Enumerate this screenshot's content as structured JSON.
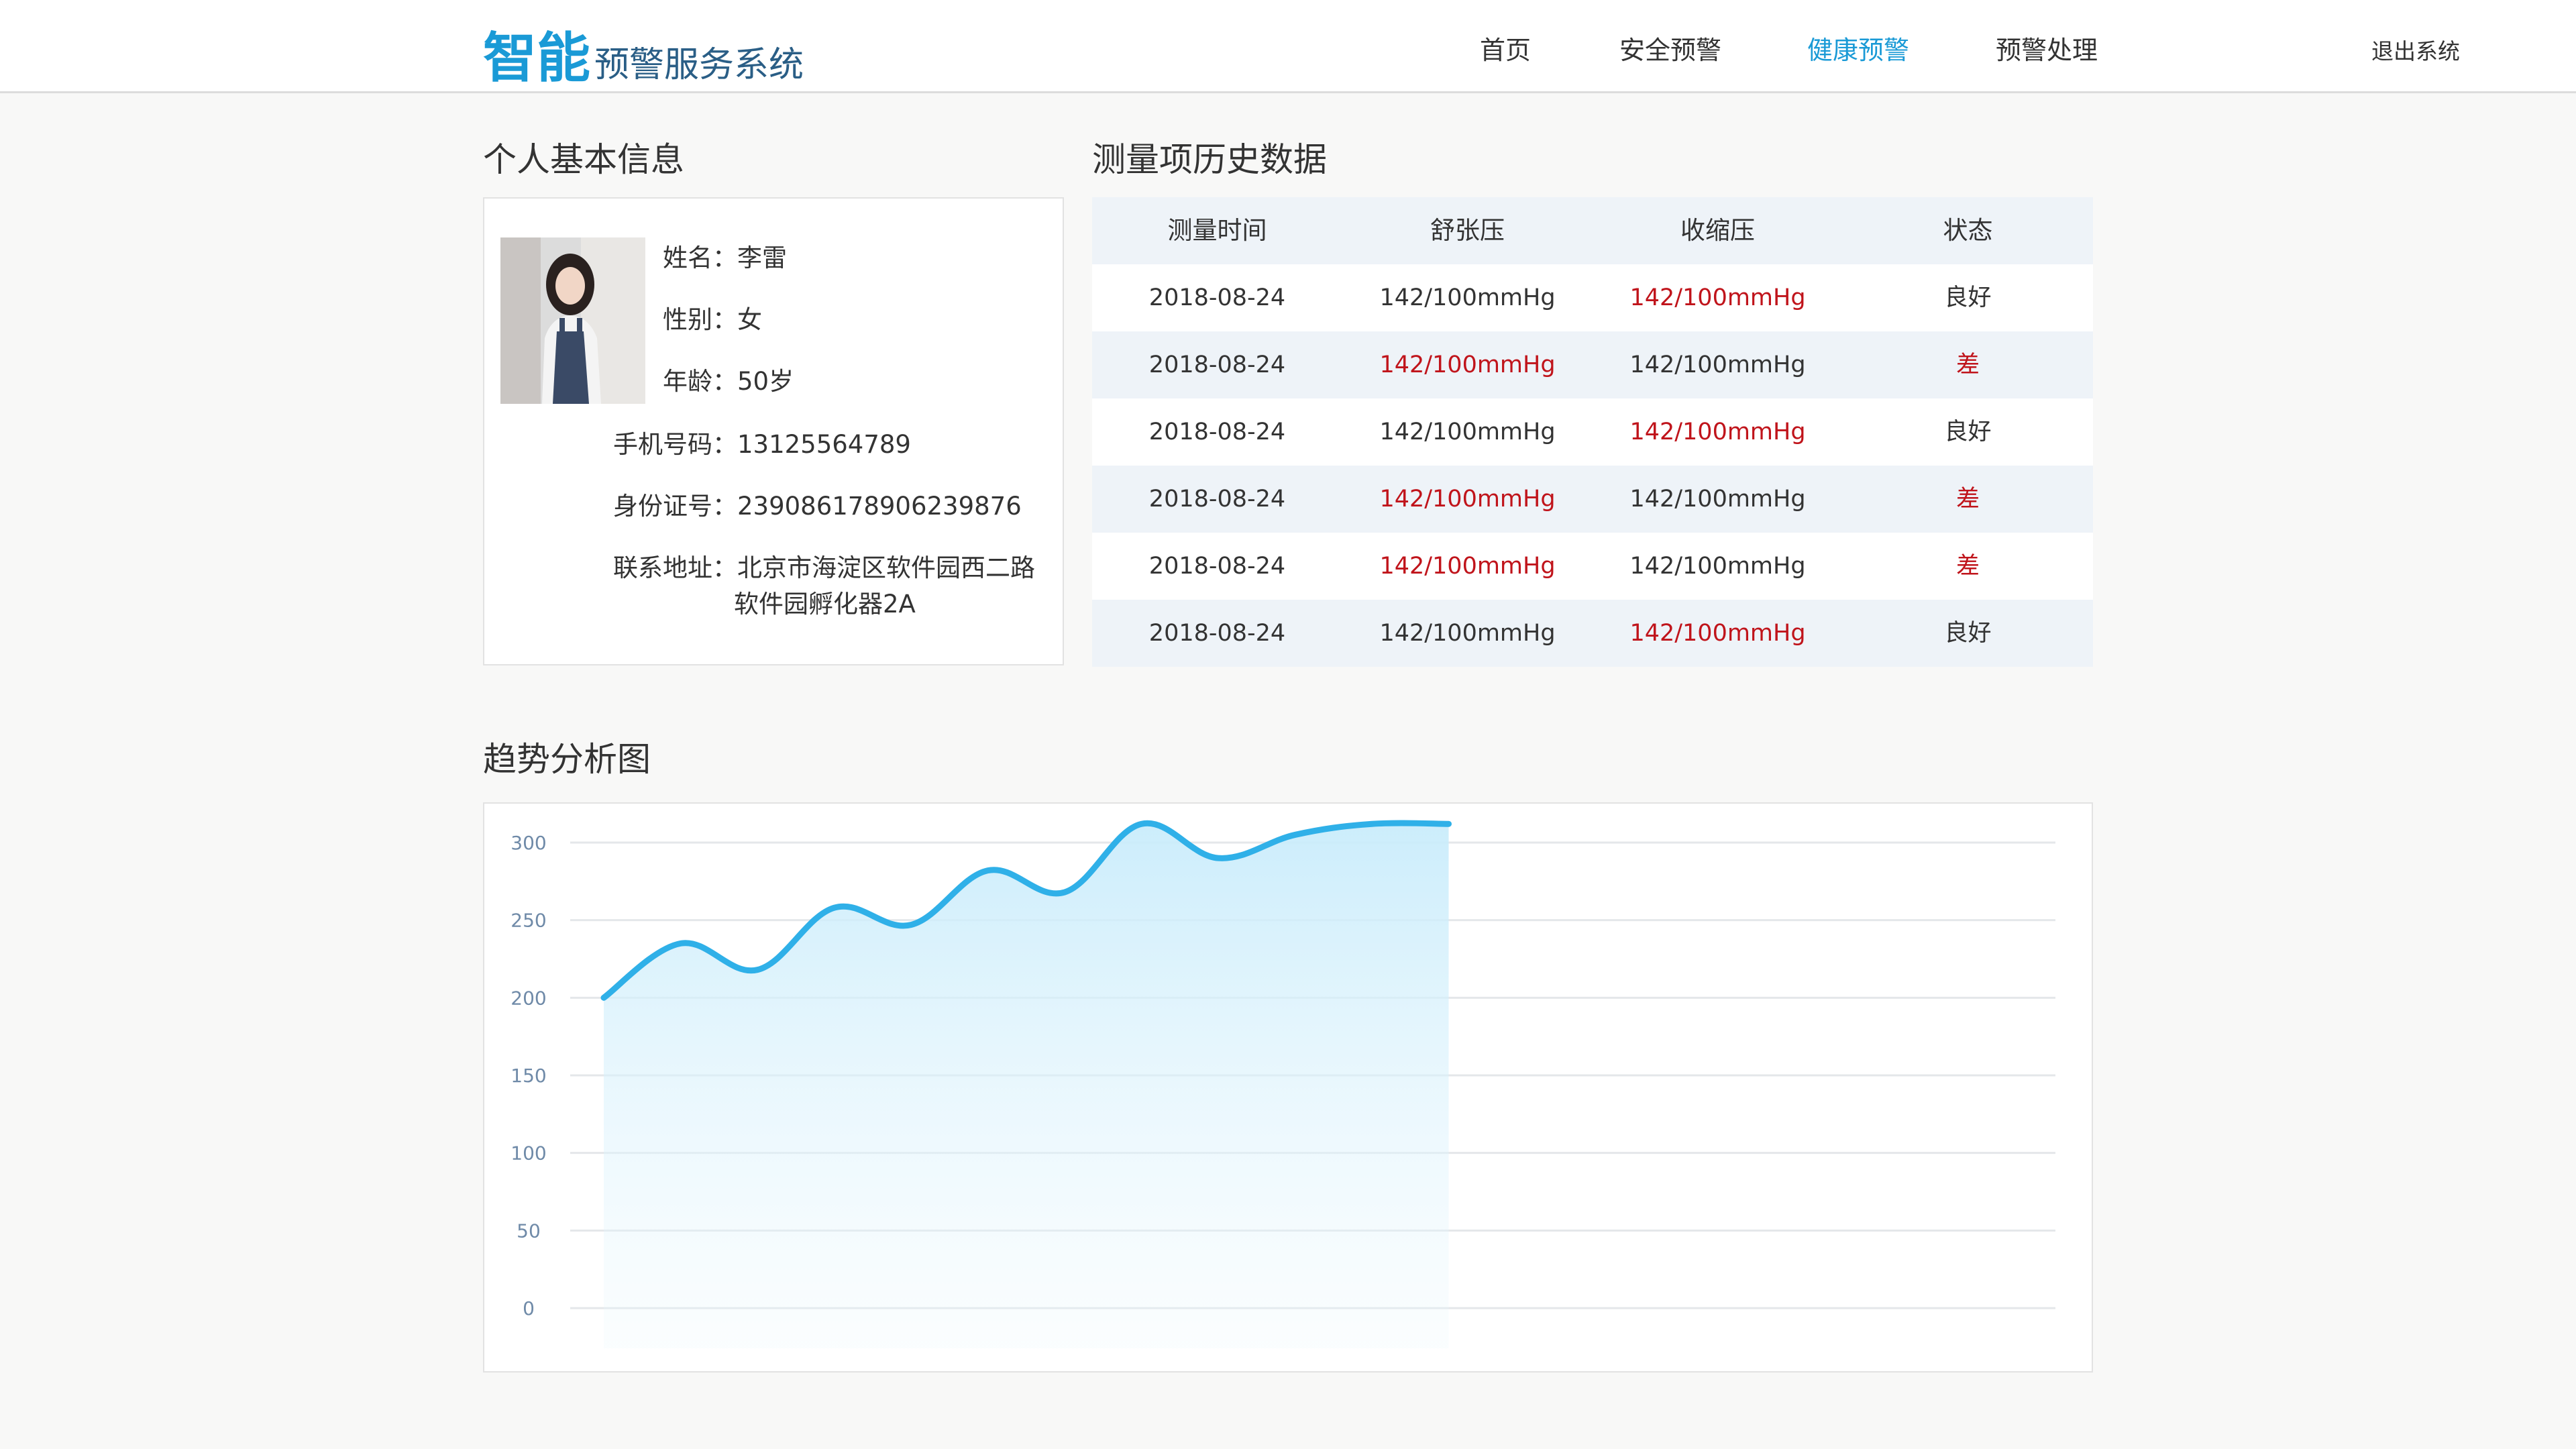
{
  "header": {
    "logo_big": "智能",
    "logo_small": "预警服务系统",
    "nav": [
      {
        "label": "首页",
        "active": false
      },
      {
        "label": "安全预警",
        "active": false
      },
      {
        "label": "健康预警",
        "active": true
      },
      {
        "label": "预警处理",
        "active": false
      }
    ],
    "logout": "退出系统",
    "accent_color": "#1a9ad6"
  },
  "profile": {
    "title": "个人基本信息",
    "fields": [
      {
        "label": "姓名：",
        "value": "李雷"
      },
      {
        "label": "性别：",
        "value": "女"
      },
      {
        "label": "年龄：",
        "value": "50岁"
      },
      {
        "label": "手机号码：",
        "value": "13125564789"
      },
      {
        "label": "身份证号：",
        "value": "239086178906239876"
      },
      {
        "label": "联系地址：",
        "value": "北京市海淀区软件园西二路",
        "value_line2": "软件园孵化器2A"
      }
    ]
  },
  "history": {
    "title": "测量项历史数据",
    "columns": [
      "测量时间",
      "舒张压",
      "收缩压",
      "状态"
    ],
    "rows": [
      {
        "time": "2018-08-24",
        "diastolic": "142/100mmHg",
        "systolic": "142/100mmHg",
        "status": "良好",
        "warn": [
          false,
          true,
          false
        ]
      },
      {
        "time": "2018-08-24",
        "diastolic": "142/100mmHg",
        "systolic": "142/100mmHg",
        "status": "差",
        "warn": [
          true,
          false,
          true
        ]
      },
      {
        "time": "2018-08-24",
        "diastolic": "142/100mmHg",
        "systolic": "142/100mmHg",
        "status": "良好",
        "warn": [
          false,
          true,
          false
        ]
      },
      {
        "time": "2018-08-24",
        "diastolic": "142/100mmHg",
        "systolic": "142/100mmHg",
        "status": "差",
        "warn": [
          true,
          false,
          true
        ]
      },
      {
        "time": "2018-08-24",
        "diastolic": "142/100mmHg",
        "systolic": "142/100mmHg",
        "status": "差",
        "warn": [
          true,
          false,
          true
        ]
      },
      {
        "time": "2018-08-24",
        "diastolic": "142/100mmHg",
        "systolic": "142/100mmHg",
        "status": "良好",
        "warn": [
          false,
          true,
          false
        ]
      }
    ],
    "warn_color": "#c0141b"
  },
  "trend": {
    "title": "趋势分析图"
  },
  "chart_data": {
    "type": "area",
    "title": "",
    "xlabel": "",
    "ylabel": "",
    "ylim": [
      0,
      300
    ],
    "yticks": [
      0,
      50,
      100,
      150,
      200,
      250,
      300
    ],
    "grid": true,
    "x": [
      1,
      2,
      3,
      4,
      5,
      6,
      7,
      8,
      9,
      10,
      11,
      12
    ],
    "x_max": 22,
    "series": [
      {
        "values": [
          200,
          235,
          218,
          258,
          247,
          282,
          268,
          312,
          290,
          305,
          312,
          312
        ],
        "color": "#2fb0e8"
      }
    ]
  }
}
